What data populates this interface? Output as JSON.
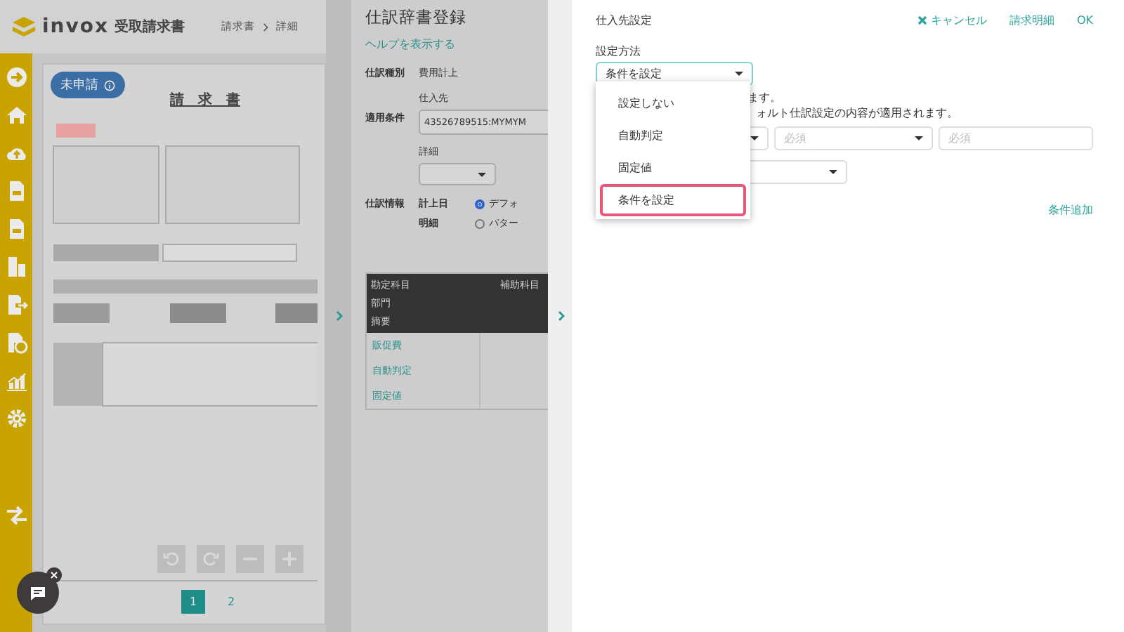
{
  "header": {
    "app_name": "invox",
    "product": "受取請求書",
    "breadcrumb": [
      "請求書",
      "詳細"
    ]
  },
  "viewer": {
    "status_badge": "未申請",
    "document_title": "請　求　書",
    "pages": [
      {
        "label": "1",
        "selected": true
      },
      {
        "label": "2",
        "selected": false
      }
    ]
  },
  "dictionary": {
    "title": "仕訳辞書登録",
    "help_link": "ヘルプを表示する",
    "type_label": "仕訳種別",
    "type_value": "費用計上",
    "condition_label": "適用条件",
    "supplier_label": "仕入先",
    "supplier_value": "43526789515:MYMYM",
    "detail_label": "詳細",
    "info_label": "仕訳情報",
    "info_rows": [
      {
        "label": "計上日",
        "option": "デフォ",
        "checked": true
      },
      {
        "label": "明細",
        "option": "パター",
        "checked": false
      }
    ],
    "table": {
      "header": [
        "勘定科目",
        "補助科目",
        "部門",
        "摘要"
      ],
      "rows": [
        "販促費",
        "自動判定",
        "固定値"
      ]
    }
  },
  "supplier_settings": {
    "title": "仕入先設定",
    "actions": [
      "キャンセル",
      "請求明細",
      "OK"
    ],
    "method_label": "設定方法",
    "method_value": "条件を設定",
    "options": [
      {
        "label": "設定しない",
        "selected": false
      },
      {
        "label": "自動判定",
        "selected": false
      },
      {
        "label": "固定値",
        "selected": false
      },
      {
        "label": "条件を設定",
        "selected": true
      }
    ],
    "notes": [
      "ます。",
      "ォルト仕訳設定の内容が適用されます。"
    ],
    "condition_fields": [
      {
        "kind": "select",
        "placeholder": "必須"
      },
      {
        "kind": "input",
        "placeholder": "必須"
      }
    ],
    "add_condition": "条件追加"
  }
}
